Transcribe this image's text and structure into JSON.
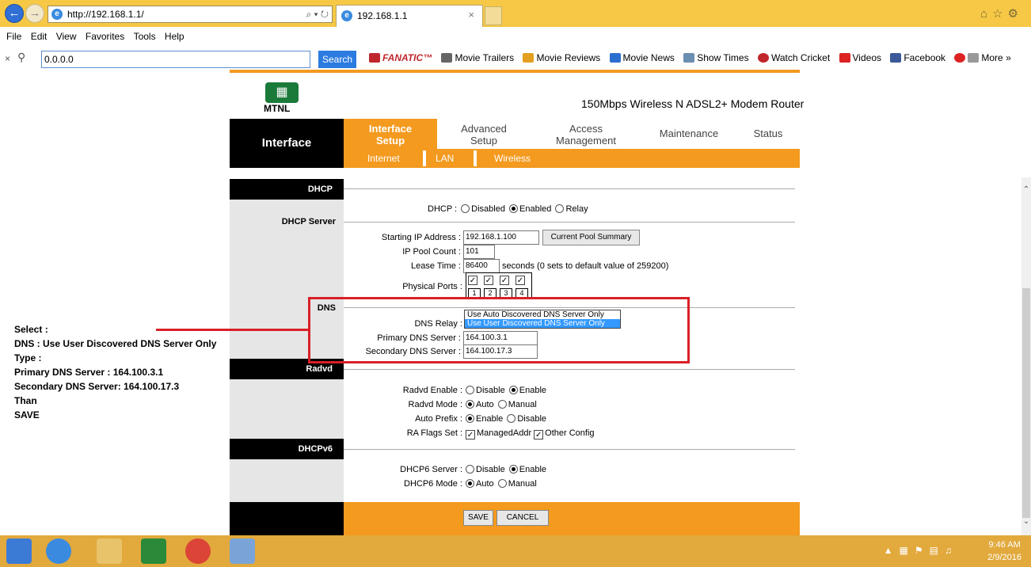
{
  "browser": {
    "url": "http://192.168.1.1/",
    "address_tools": "⌕ ▾ ↻",
    "tab_title": "192.168.1.1",
    "menu": [
      "File",
      "Edit",
      "View",
      "Favorites",
      "Tools",
      "Help"
    ],
    "toolbar": {
      "search_value": "0.0.0.0",
      "search_button": "Search",
      "links": [
        {
          "label": "FANATIC™",
          "icon": "film-logo"
        },
        {
          "label": "Movie Trailers",
          "icon": "film-reel-icon"
        },
        {
          "label": "Movie Reviews",
          "icon": "thumbs-icon"
        },
        {
          "label": "Movie News",
          "icon": "megaphone-icon"
        },
        {
          "label": "Show Times",
          "icon": "calendar-icon"
        },
        {
          "label": "Watch Cricket",
          "icon": "cricket-ball-icon"
        },
        {
          "label": "Videos",
          "icon": "youtube-icon"
        },
        {
          "label": "Facebook",
          "icon": "facebook-icon"
        },
        {
          "label": "More »",
          "icon": "tools-icon"
        }
      ]
    }
  },
  "router": {
    "brand": "MTNL",
    "product": "150Mbps Wireless N ADSL2+ Modem Router",
    "section_title": "Interface",
    "nav": [
      {
        "label": "Interface Setup",
        "active": true
      },
      {
        "label": "Advanced Setup"
      },
      {
        "label": "Access Management"
      },
      {
        "label": "Maintenance"
      },
      {
        "label": "Status"
      }
    ],
    "subnav": [
      "Internet",
      "LAN",
      "Wireless"
    ],
    "sections": {
      "dhcp": "DHCP",
      "dhcp_server": "DHCP Server",
      "dns": "DNS",
      "radvd": "Radvd",
      "dhcpv6": "DHCPv6"
    },
    "dhcp": {
      "label": "DHCP :",
      "options": [
        "Disabled",
        "Enabled",
        "Relay"
      ],
      "selected": "Enabled"
    },
    "dhcp_server": {
      "start_ip_label": "Starting IP Address :",
      "start_ip": "192.168.1.100",
      "pool_button": "Current Pool Summary",
      "pool_count_label": "IP Pool Count :",
      "pool_count": "101",
      "lease_label": "Lease Time :",
      "lease": "86400",
      "lease_note": "seconds   (0 sets to default value of 259200)",
      "ports_label": "Physical Ports :",
      "ports": [
        "1",
        "2",
        "3",
        "4"
      ]
    },
    "dns": {
      "relay_label": "DNS Relay :",
      "relay_options": [
        "Use Auto Discovered DNS Server Only",
        "Use User Discovered DNS Server Only"
      ],
      "primary_label": "Primary DNS Server :",
      "primary": "164.100.3.1",
      "secondary_label": "Secondary DNS Server :",
      "secondary": "164.100.17.3"
    },
    "radvd": {
      "enable_label": "Radvd Enable :",
      "enable_options": [
        "Disable",
        "Enable"
      ],
      "mode_label": "Radvd Mode :",
      "mode_options": [
        "Auto",
        "Manual"
      ],
      "prefix_label": "Auto Prefix :",
      "prefix_options": [
        "Enable",
        "Disable"
      ],
      "flags_label": "RA Flags Set :",
      "flags": [
        "ManagedAddr",
        "Other Config"
      ]
    },
    "dhcpv6": {
      "server_label": "DHCP6 Server :",
      "server_options": [
        "Disable",
        "Enable"
      ],
      "mode_label": "DHCP6 Mode :",
      "mode_options": [
        "Auto",
        "Manual"
      ]
    },
    "buttons": {
      "save": "SAVE",
      "cancel": "CANCEL"
    }
  },
  "annotation": [
    "Select :",
    "DNS : Use User Discovered DNS Server Only",
    "Type :",
    "Primary DNS Server :    164.100.3.1",
    "Secondary DNS Server: 164.100.17.3",
    "Than",
    "SAVE"
  ],
  "taskbar": {
    "time": "9:46 AM",
    "date": "2/9/2016"
  }
}
